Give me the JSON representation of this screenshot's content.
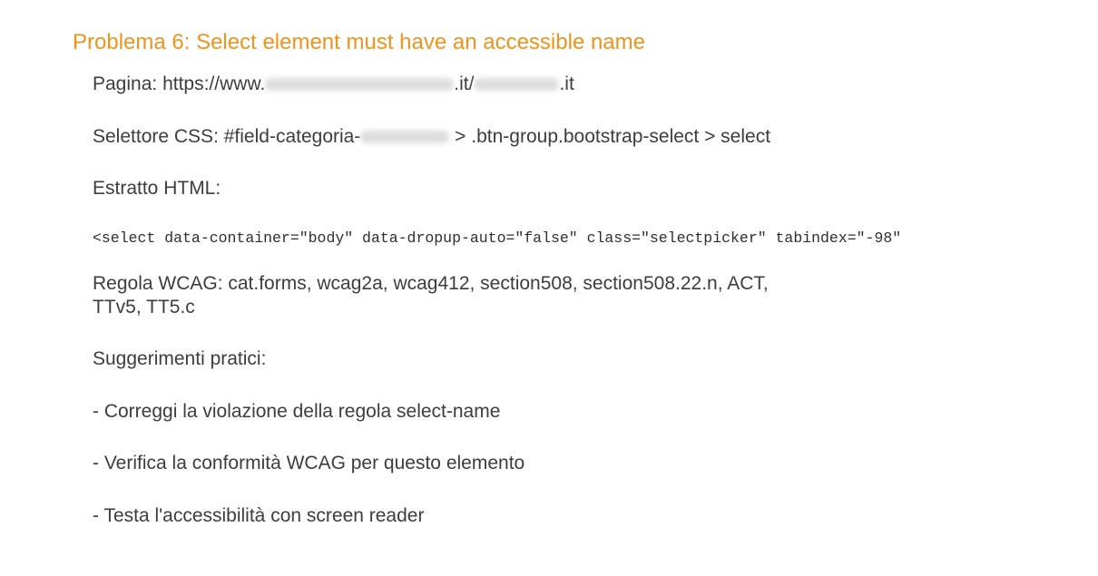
{
  "heading": "Problema 6: Select element must have an accessible name",
  "page": {
    "label": "Pagina:",
    "url_prefix": "https://www.",
    "url_middle": ".it/",
    "url_suffix": ".it"
  },
  "selector": {
    "label": "Selettore CSS:",
    "prefix": "#field-categoria-",
    "suffix": " > .btn-group.bootstrap-select > select"
  },
  "html_excerpt": {
    "label": "Estratto HTML:",
    "code": "<select data-container=\"body\" data-dropup-auto=\"false\" class=\"selectpicker\" tabindex=\"-98\""
  },
  "wcag": {
    "line1": "Regola WCAG: cat.forms, wcag2a, wcag412, section508, section508.22.n, ACT,",
    "line2": "TTv5, TT5.c"
  },
  "suggestions": {
    "label": "Suggerimenti pratici:",
    "items": [
      "- Correggi la violazione della regola select-name",
      "- Verifica la conformità WCAG per questo elemento",
      "- Testa l'accessibilità con screen reader"
    ]
  }
}
